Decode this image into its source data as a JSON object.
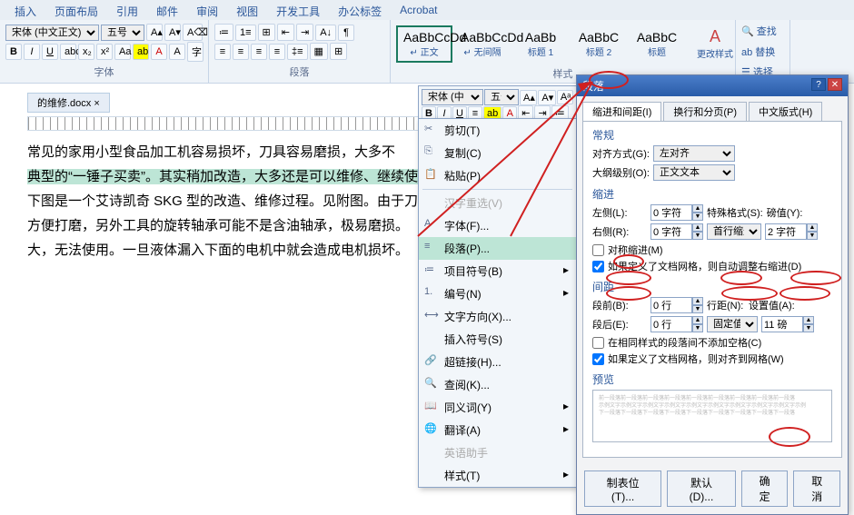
{
  "ribbon_tabs": [
    "插入",
    "页面布局",
    "引用",
    "邮件",
    "审阅",
    "视图",
    "开发工具",
    "办公标签",
    "Acrobat"
  ],
  "font_group": {
    "font": "宋体 (中文正文)",
    "size": "五号",
    "label": "字体"
  },
  "para_group": {
    "label": "段落"
  },
  "styles_group": {
    "label": "样式",
    "items": [
      {
        "preview": "AaBbCcDd",
        "name": "↵ 正文",
        "sel": true
      },
      {
        "preview": "AaBbCcDd",
        "name": "↵ 无间隔"
      },
      {
        "preview": "AaBb",
        "name": "标题 1"
      },
      {
        "preview": "AaBbC",
        "name": "标题 2"
      },
      {
        "preview": "AaBbC",
        "name": "标题"
      }
    ],
    "change": "更改样式"
  },
  "edit_group": {
    "find": "查找",
    "replace": "替换",
    "select": "选择"
  },
  "doc_tab": "的维修.docx",
  "doc_lines": [
    {
      "t": "    常见的家用小型食品加工机容易损坏，刀具容易磨损，大多不",
      "hl": false
    },
    {
      "t": "典型的“一锤子买卖”。其实稍加改造，大多还是可以维修、继续使用的。",
      "hl": true
    },
    {
      "t": "下图是一个艾诗凯奇 SKG 型的改造、维修过程。见附图。由于刀",
      "hl": false
    },
    {
      "t": "方便打磨，另外工具的旋转轴承可能不是含油轴承，极易磨损。",
      "hl": false
    },
    {
      "t": "大，无法使用。一旦液体漏入下面的电机中就会造成电机损坏。",
      "hl": false
    }
  ],
  "mini_tb": {
    "font": "宋体 (中ゞ",
    "size": "五号"
  },
  "ctx": [
    {
      "ico": "✂",
      "t": "剪切(T)"
    },
    {
      "ico": "⎘",
      "t": "复制(C)"
    },
    {
      "ico": "📋",
      "t": "粘贴(P)"
    },
    {
      "sep": true
    },
    {
      "ico": "",
      "t": "汉字重选(V)",
      "dis": true
    },
    {
      "ico": "A",
      "t": "字体(F)..."
    },
    {
      "ico": "≡",
      "t": "段落(P)...",
      "hl": true
    },
    {
      "ico": "≔",
      "t": "项目符号(B)",
      "arrow": true
    },
    {
      "ico": "1.",
      "t": "编号(N)",
      "arrow": true
    },
    {
      "ico": "⟷",
      "t": "文字方向(X)..."
    },
    {
      "ico": "",
      "t": "插入符号(S)"
    },
    {
      "ico": "🔗",
      "t": "超链接(H)..."
    },
    {
      "ico": "🔍",
      "t": "查阅(K)..."
    },
    {
      "ico": "📖",
      "t": "同义词(Y)",
      "arrow": true
    },
    {
      "ico": "🌐",
      "t": "翻译(A)",
      "arrow": true
    },
    {
      "ico": "",
      "t": "英语助手",
      "dis": true
    },
    {
      "ico": "",
      "t": "样式(T)",
      "arrow": true
    }
  ],
  "dlg": {
    "title": "段落",
    "tabs": [
      "缩进和间距(I)",
      "换行和分页(P)",
      "中文版式(H)"
    ],
    "general": {
      "title": "常规",
      "align_l": "对齐方式(G):",
      "align_v": "左对齐",
      "outline_l": "大纲级别(O):",
      "outline_v": "正文文本"
    },
    "indent": {
      "title": "缩进",
      "left_l": "左侧(L):",
      "left_v": "0 字符",
      "right_l": "右侧(R):",
      "right_v": "0 字符",
      "special_l": "特殊格式(S):",
      "special_v": "首行缩进",
      "by_l": "磅值(Y):",
      "by_v": "2 字符",
      "chk1": "对称缩进(M)",
      "chk2": "如果定义了文档网格，则自动调整右缩进(D)"
    },
    "spacing": {
      "title": "间距",
      "before_l": "段前(B):",
      "before_v": "0 行",
      "after_l": "段后(E):",
      "after_v": "0 行",
      "line_l": "行距(N):",
      "line_v": "固定值",
      "at_l": "设置值(A):",
      "at_v": "11 磅",
      "chk1": "在相同样式的段落间不添加空格(C)",
      "chk2": "如果定义了文档网格，则对齐到网格(W)"
    },
    "preview_title": "预览",
    "btns": {
      "tabs": "制表位(T)...",
      "default": "默认(D)...",
      "ok": "确定",
      "cancel": "取消"
    }
  }
}
